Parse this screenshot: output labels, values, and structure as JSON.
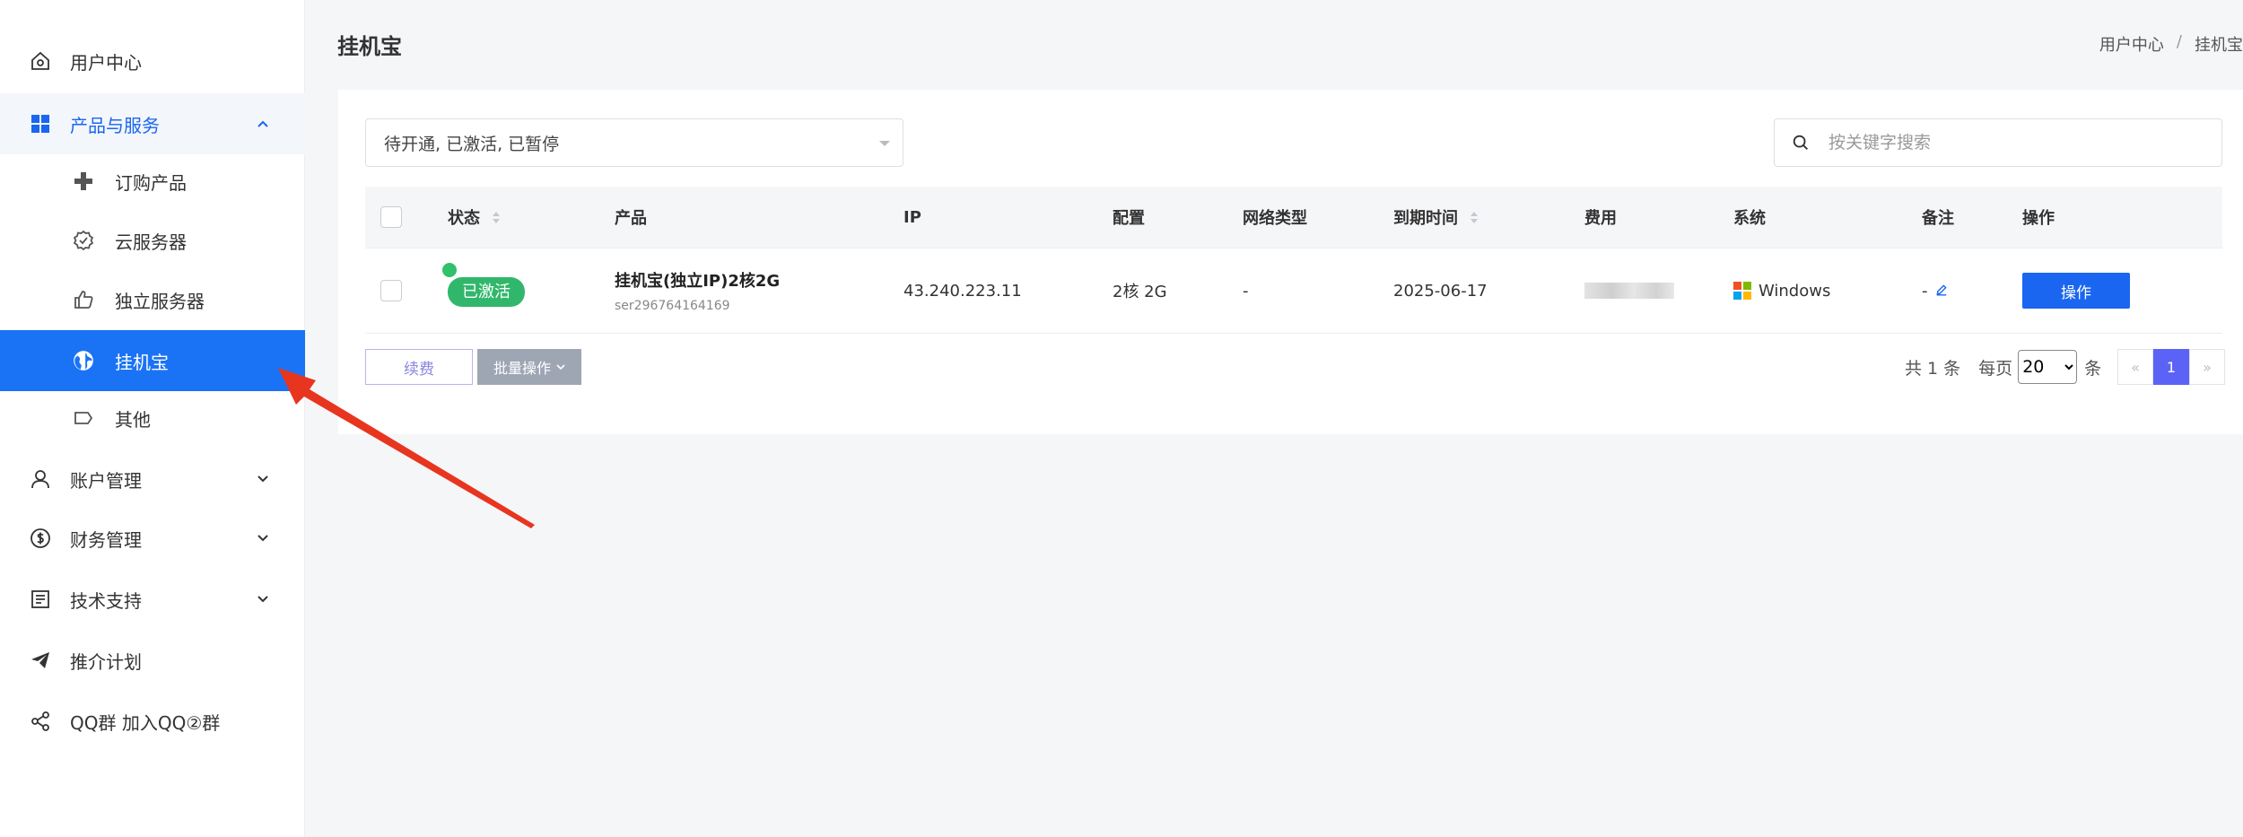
{
  "sidebar": {
    "items": [
      {
        "label": "用户中心",
        "icon": "home-icon"
      },
      {
        "label": "产品与服务",
        "icon": "grid-icon",
        "expanded": true
      },
      {
        "label": "订购产品",
        "icon": "plus-icon"
      },
      {
        "label": "云服务器",
        "icon": "cloud-server-icon"
      },
      {
        "label": "独立服务器",
        "icon": "thumbs-up-icon"
      },
      {
        "label": "挂机宝",
        "icon": "globe-icon",
        "active": true
      },
      {
        "label": "其他",
        "icon": "tag-icon"
      },
      {
        "label": "账户管理",
        "icon": "user-icon"
      },
      {
        "label": "财务管理",
        "icon": "dollar-icon"
      },
      {
        "label": "技术支持",
        "icon": "document-icon"
      },
      {
        "label": "推介计划",
        "icon": "send-icon"
      },
      {
        "label": "QQ群 加入QQ②群",
        "icon": "share-icon"
      }
    ]
  },
  "header": {
    "title": "挂机宝",
    "breadcrumb": [
      "用户中心",
      "挂机宝"
    ]
  },
  "filters": {
    "status_value": "待开通, 已激活, 已暂停",
    "search_placeholder": "按关键字搜索"
  },
  "table": {
    "columns": [
      "状态",
      "产品",
      "IP",
      "配置",
      "网络类型",
      "到期时间",
      "费用",
      "系统",
      "备注",
      "操作"
    ],
    "rows": [
      {
        "status": "已激活",
        "product_name": "挂机宝(独立IP)2核2G",
        "product_id": "ser296764164169",
        "ip": "43.240.223.11",
        "config": "2核 2G",
        "network": "-",
        "expire": "2025-06-17",
        "fee": "",
        "os": "Windows",
        "remark": "-",
        "action": "操作"
      }
    ]
  },
  "footer": {
    "renew_label": "续费",
    "batch_label": "批量操作",
    "total_text": "共 1 条",
    "per_page_label": "每页",
    "per_page_value": "20",
    "per_page_unit": "条",
    "prev": "«",
    "current_page": "1",
    "next": "»"
  },
  "colors": {
    "accent": "#1a73f5",
    "status_active": "#31b76b",
    "pager_active": "#5b63f6",
    "annotation_arrow": "#e8351f"
  }
}
